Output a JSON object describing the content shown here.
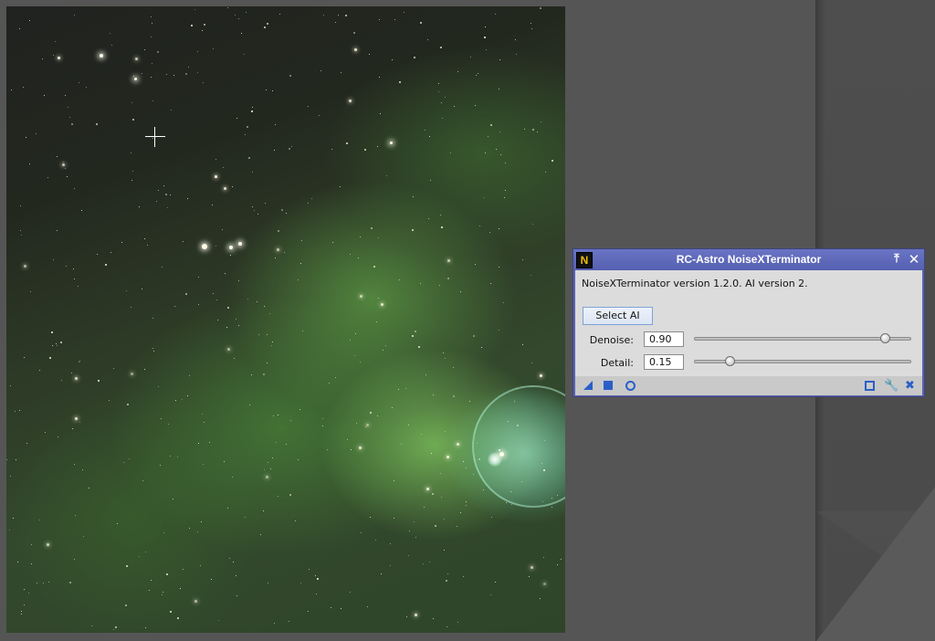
{
  "image_window": {
    "content": "nebula-image"
  },
  "dialog": {
    "title": "RC-Astro NoiseXTerminator",
    "app_icon_letter": "N",
    "version_text": "NoiseXTerminator version 1.2.0. AI version 2.",
    "select_ai_label": "Select AI",
    "denoise": {
      "label": "Denoise:",
      "value": "0.90",
      "slider_fraction": 0.9
    },
    "detail": {
      "label": "Detail:",
      "value": "0.15",
      "slider_fraction": 0.15
    },
    "titlebar_icons": [
      "shade-icon",
      "close-icon"
    ],
    "bottom_icons": [
      "new-instance-icon",
      "apply-icon",
      "apply-global-icon",
      "preview-icon",
      "reset-icon",
      "collapse-icon"
    ]
  },
  "colors": {
    "dialog_titlebar": "#5a63b0",
    "dialog_body": "#dcdcdc",
    "icon_blue": "#2a5fc8",
    "workspace": "#555555"
  }
}
